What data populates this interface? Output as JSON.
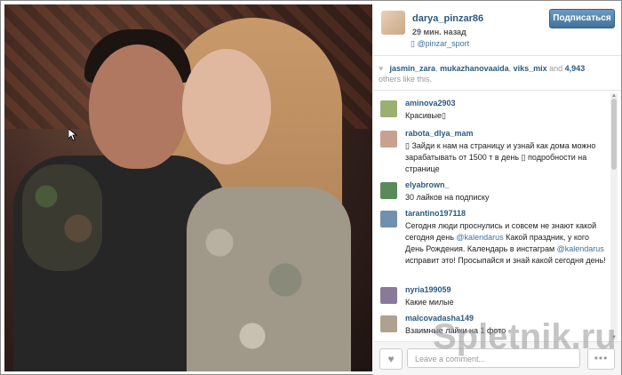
{
  "post": {
    "username": "darya_pinzar86",
    "time_ago": "29 мин. назад",
    "location": "▯ @pinzar_sport",
    "follow_label": "Подписаться"
  },
  "likes": {
    "users": [
      "jasmin_zara",
      "mukazhanovaaida",
      "viks_mix"
    ],
    "sep1": ", ",
    "sep2": ", ",
    "and_text": " and ",
    "count": "4,943",
    "suffix": "others like this."
  },
  "comments": [
    {
      "user": "aminova2903",
      "text": "Красивые▯"
    },
    {
      "user": "rabota_dlya_mam",
      "text": "▯ Зайди к нам на страницу и узнай как дома можно зарабатывать от 1500 т в день ▯ подробности на странице"
    },
    {
      "user": "elyabrown_",
      "text": "30 лайков на подписку"
    },
    {
      "user": "tarantino197118",
      "text_parts": [
        "Сегодня люди проснулись и совсем не знают какой сегодня день ",
        "@kalendarus",
        " Какой праздник, у кого День Рождения. Календарь в инстаграм ",
        "@kalendarus",
        " исправит это! Просыпайся и знай какой сегодня день!"
      ]
    },
    {
      "user": "nyria199059",
      "text": "Какие милые"
    },
    {
      "user": "malcovadasha149",
      "text": "Взаимные лайки на 1 фото"
    }
  ],
  "footer": {
    "comment_placeholder": "Leave a comment...",
    "more_label": "•••"
  },
  "watermark": "Spletnik.ru",
  "colors": {
    "accent": "#3f729b",
    "username": "#2b5a83"
  },
  "icons": {
    "like": "heart-icon",
    "more": "more-icon",
    "location": "location-pin-icon"
  }
}
